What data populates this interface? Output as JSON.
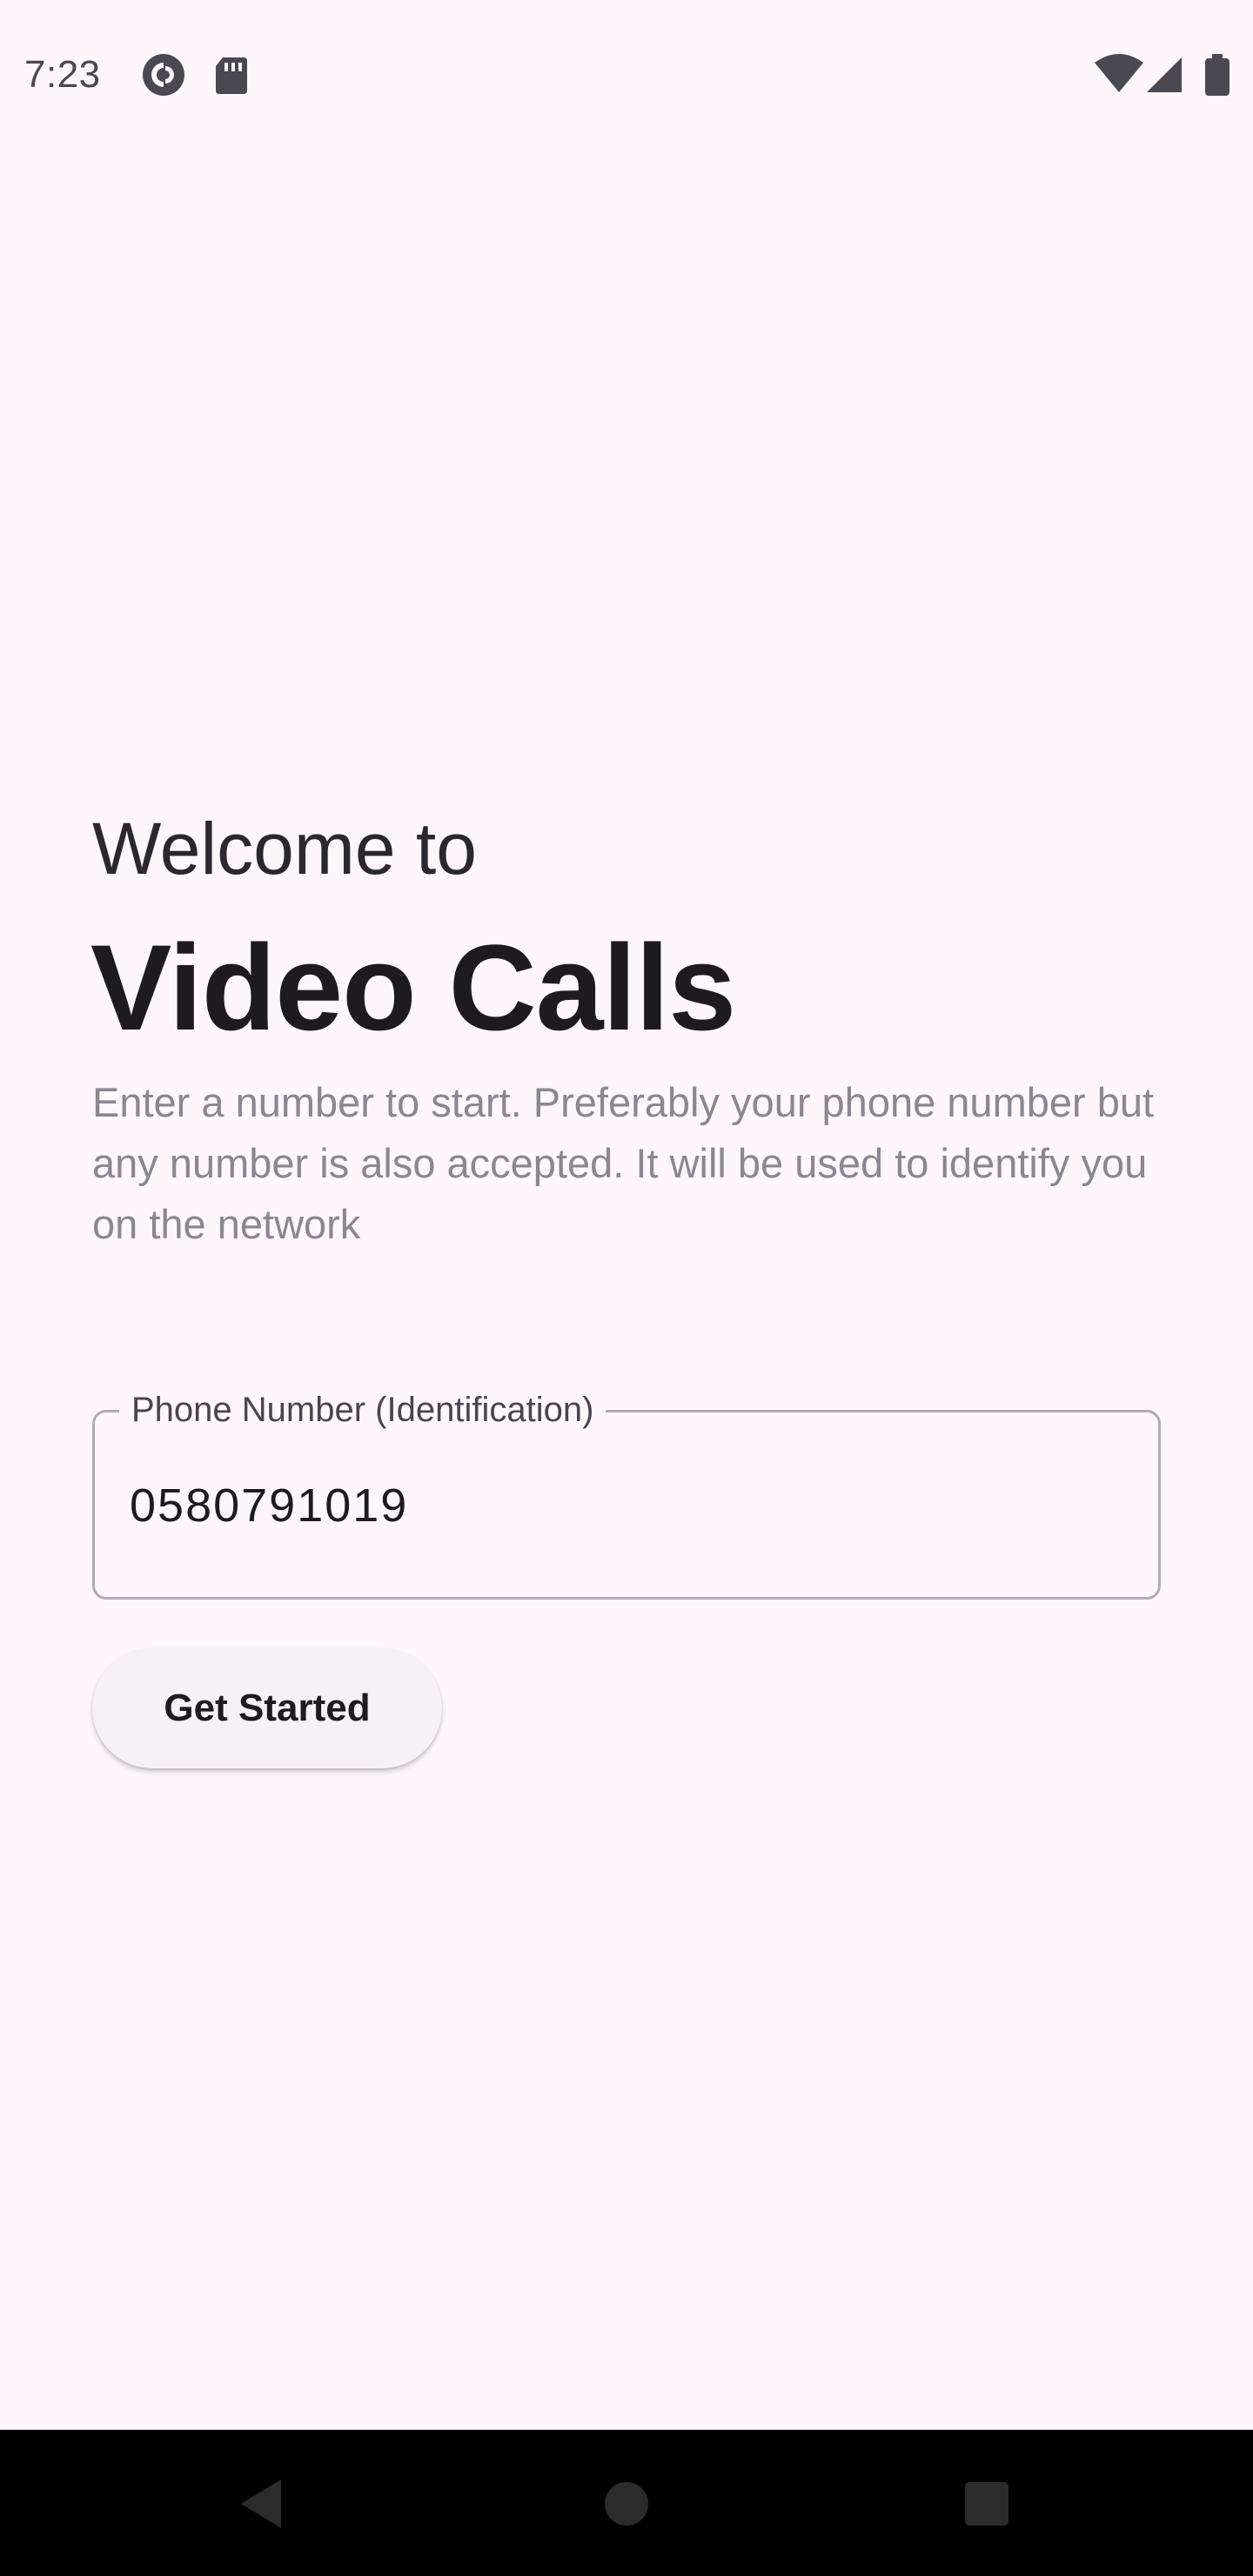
{
  "status_bar": {
    "time": "7:23",
    "left_icons": [
      "pocket-casts-icon",
      "sd-card-icon"
    ],
    "right_icons": [
      "wifi-icon",
      "cellular-signal-icon",
      "battery-icon"
    ]
  },
  "welcome": {
    "greeting": "Welcome to",
    "app_name": "Video Calls",
    "description": "Enter a number to start. Preferably your phone number but any number is also accepted. It will be used to identify you on the network"
  },
  "phone_field": {
    "label": "Phone Number (Identification)",
    "value": "0580791019"
  },
  "actions": {
    "get_started_label": "Get Started"
  },
  "nav_bar": {
    "buttons": [
      "back-icon",
      "home-icon",
      "recents-icon"
    ]
  },
  "colors": {
    "background": "#FDF7FC",
    "text_primary": "#1D1B20",
    "text_secondary": "#8A8790",
    "field_border": "#B0ABB4",
    "button_surface": "#F5F1F6",
    "nav_bar": "#000000"
  }
}
